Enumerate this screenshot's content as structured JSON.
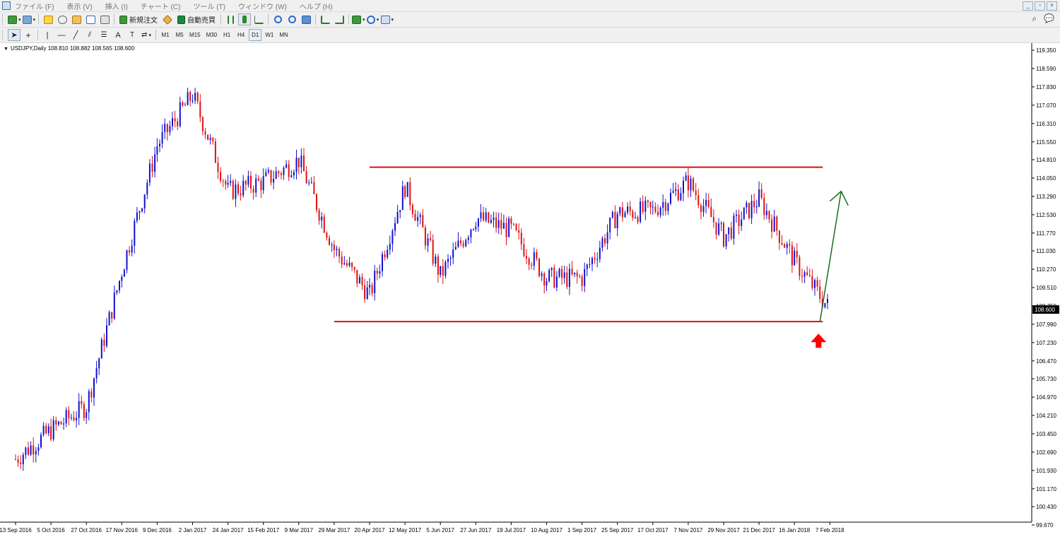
{
  "window": {
    "menu": [
      "ファイル (F)",
      "表示 (V)",
      "挿入 (I)",
      "チャート (C)",
      "ツール (T)",
      "ウィンドウ (W)",
      "ヘルプ (H)"
    ]
  },
  "toolbar": {
    "new_order_label": "新規注文",
    "auto_trade_label": "自動売買",
    "timeframes": [
      "M1",
      "M5",
      "M15",
      "M30",
      "H1",
      "H4",
      "D1",
      "W1",
      "MN"
    ],
    "active_timeframe": "D1"
  },
  "chart": {
    "title": "USDJPY,Daily  108.810 108.882 108.565 108.600",
    "current_price_label": "108.600",
    "y_ticks": [
      "119.350",
      "118.590",
      "117.830",
      "117.070",
      "116.310",
      "115.550",
      "114.810",
      "114.050",
      "113.290",
      "112.530",
      "111.770",
      "111.030",
      "110.270",
      "109.510",
      "108.750",
      "107.990",
      "107.230",
      "106.470",
      "105.730",
      "104.970",
      "104.210",
      "103.450",
      "102.690",
      "101.930",
      "101.170",
      "100.430",
      "99.670"
    ],
    "x_ticks": [
      "13 Sep 2016",
      "5 Oct 2016",
      "27 Oct 2016",
      "17 Nov 2016",
      "9 Dec 2016",
      "2 Jan 2017",
      "24 Jan 2017",
      "15 Feb 2017",
      "9 Mar 2017",
      "29 Mar 2017",
      "20 Apr 2017",
      "12 May 2017",
      "5 Jun 2017",
      "27 Jun 2017",
      "19 Jul 2017",
      "10 Aug 2017",
      "1 Sep 2017",
      "25 Sep 2017",
      "17 Oct 2017",
      "7 Nov 2017",
      "29 Nov 2017",
      "21 Dec 2017",
      "16 Jan 2018",
      "7 Feb 2018"
    ],
    "colors": {
      "bull": "#1010d0",
      "bear": "#e01010",
      "resistance": "#e01010",
      "arrow_up": "#1a6e1a",
      "marker": "#ff0000"
    }
  },
  "chart_data": {
    "type": "candlestick",
    "symbol": "USDJPY",
    "timeframe": "Daily",
    "ohlc_last": {
      "open": 108.81,
      "high": 108.882,
      "low": 108.565,
      "close": 108.6
    },
    "ylim": [
      99.67,
      119.35
    ],
    "x_range": [
      "13 Sep 2016",
      "7 Feb 2018"
    ],
    "approx_close_path": [
      {
        "x": "13 Sep 2016",
        "y": 102.4
      },
      {
        "x": "5 Oct 2016",
        "y": 103.6
      },
      {
        "x": "27 Oct 2016",
        "y": 104.6
      },
      {
        "x": "17 Nov 2016",
        "y": 110.2
      },
      {
        "x": "9 Dec 2016",
        "y": 115.4
      },
      {
        "x": "2 Jan 2017",
        "y": 117.5
      },
      {
        "x": "24 Jan 2017",
        "y": 113.5
      },
      {
        "x": "15 Feb 2017",
        "y": 113.9
      },
      {
        "x": "9 Mar 2017",
        "y": 114.8
      },
      {
        "x": "29 Mar 2017",
        "y": 111.1
      },
      {
        "x": "20 Apr 2017",
        "y": 109.2
      },
      {
        "x": "12 May 2017",
        "y": 113.7
      },
      {
        "x": "5 Jun 2017",
        "y": 110.0
      },
      {
        "x": "27 Jun 2017",
        "y": 112.4
      },
      {
        "x": "19 Jul 2017",
        "y": 111.9
      },
      {
        "x": "10 Aug 2017",
        "y": 109.9
      },
      {
        "x": "1 Sep 2017",
        "y": 109.9
      },
      {
        "x": "25 Sep 2017",
        "y": 112.6
      },
      {
        "x": "17 Oct 2017",
        "y": 112.7
      },
      {
        "x": "7 Nov 2017",
        "y": 113.9
      },
      {
        "x": "29 Nov 2017",
        "y": 111.6
      },
      {
        "x": "21 Dec 2017",
        "y": 113.2
      },
      {
        "x": "16 Jan 2018",
        "y": 110.6
      },
      {
        "x": "7 Feb 2018",
        "y": 108.6
      }
    ],
    "annotations": [
      {
        "type": "hline",
        "label": "resistance",
        "y": 114.5,
        "from": "20 Apr 2017",
        "to": "7 Feb 2018"
      },
      {
        "type": "hline",
        "label": "support",
        "y": 108.1,
        "from": "29 Mar 2017",
        "to": "7 Feb 2018"
      },
      {
        "type": "arrow",
        "direction": "up",
        "color": "green",
        "from_y": 108.1,
        "to_y": 113.5
      },
      {
        "type": "marker",
        "shape": "arrow-up",
        "color": "red",
        "at": "7 Feb 2018"
      }
    ]
  }
}
